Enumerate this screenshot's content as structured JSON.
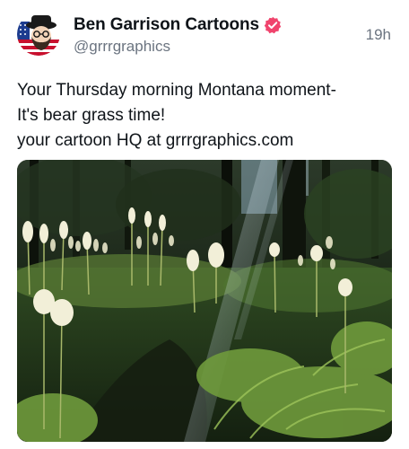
{
  "post": {
    "author": {
      "display_name": "Ben Garrison Cartoons",
      "handle": "@grrrgraphics",
      "verified": true,
      "badge_color": "#f0446d",
      "avatar_icon": "cartoon-avatar-icon"
    },
    "timestamp": "19h",
    "text_lines": [
      "Your Thursday morning Montana moment-",
      "It's bear grass time!",
      "your cartoon HQ at grrrgraphics.com"
    ],
    "media": {
      "type": "photo"
    }
  }
}
